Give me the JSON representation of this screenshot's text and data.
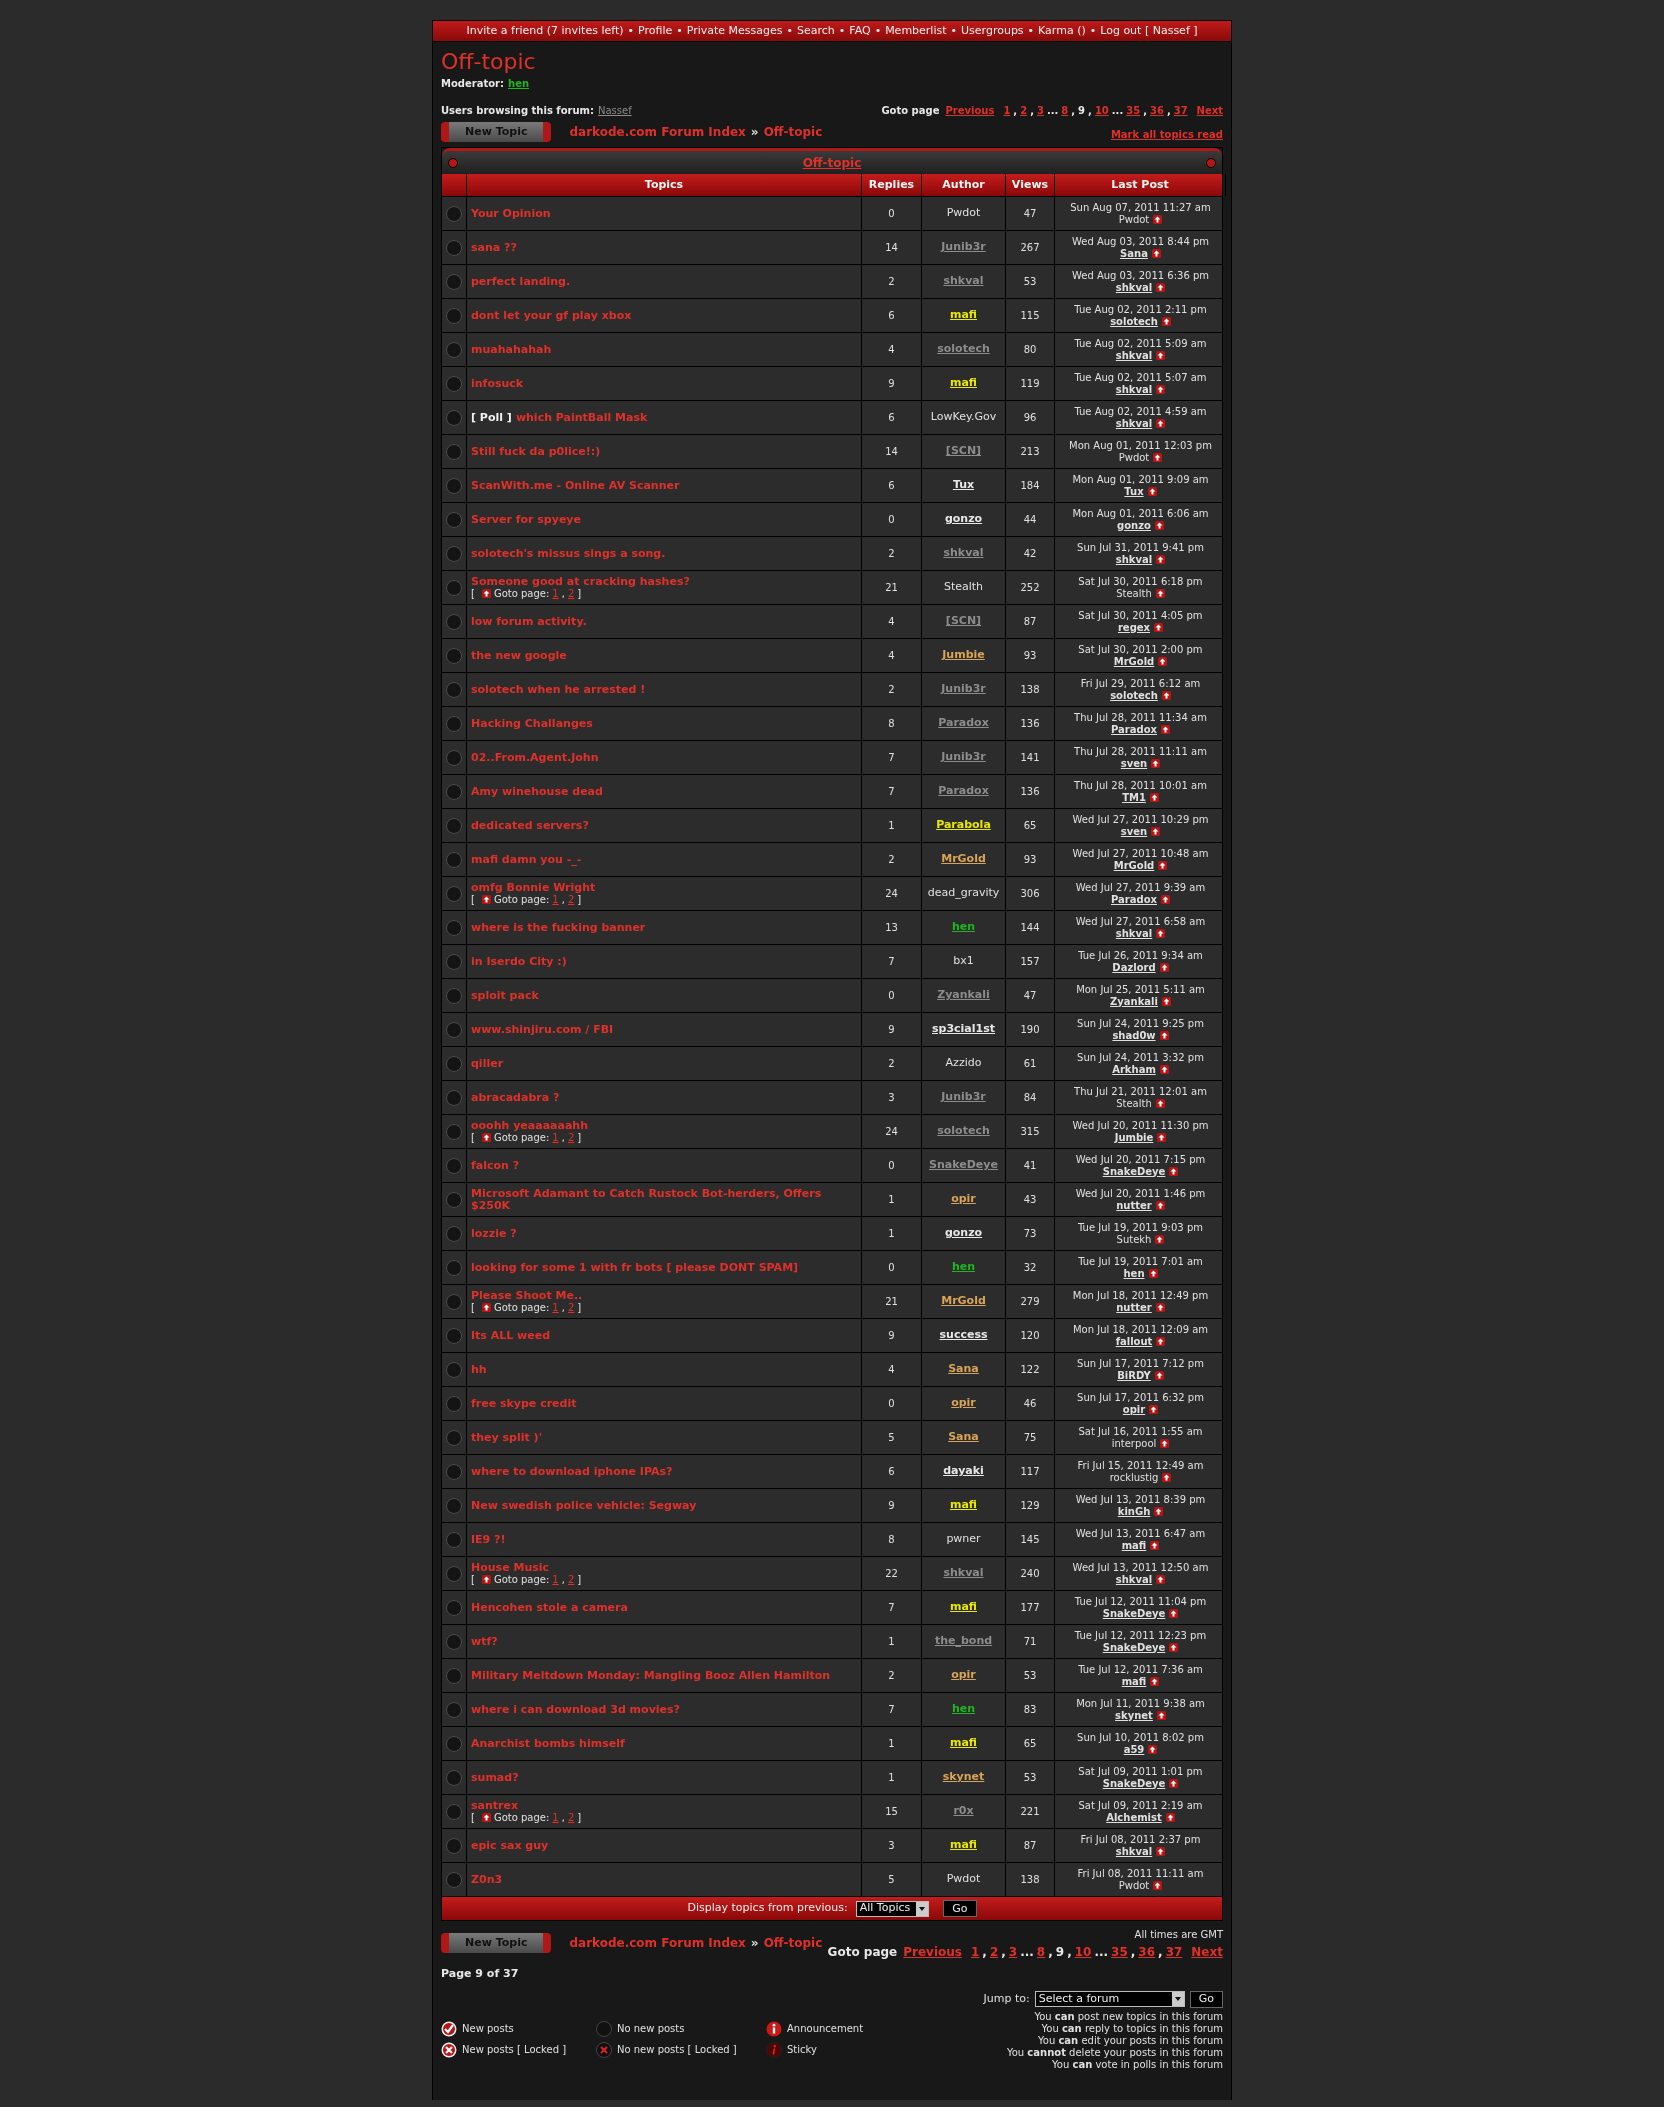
{
  "nav": {
    "separator": "•",
    "items": [
      "Invite a friend (7 invites left)",
      "Profile",
      "Private Messages",
      "Search",
      "FAQ",
      "Memberlist",
      "Usergroups",
      "Karma ()",
      "Log out [ Nassef ]"
    ]
  },
  "forum_title": "Off-topic",
  "moderator": {
    "label": "Moderator:",
    "name": "hen",
    "color": "#21b521"
  },
  "browsing": {
    "label": "Users browsing this forum:",
    "name": "Nassef",
    "color": "#8c8c8c"
  },
  "top_bar": {
    "goto_label": "Goto page",
    "pagination": [
      {
        "text": "Previous",
        "link": true
      },
      {
        "text": "1",
        "link": true
      },
      {
        "text": ",",
        "link": false
      },
      {
        "text": "2",
        "link": true
      },
      {
        "text": ",",
        "link": false
      },
      {
        "text": "3",
        "link": true
      },
      {
        "text": "...",
        "link": false
      },
      {
        "text": "8",
        "link": true
      },
      {
        "text": ",",
        "link": false
      },
      {
        "text": "9",
        "link": false
      },
      {
        "text": ",",
        "link": false
      },
      {
        "text": "10",
        "link": true
      },
      {
        "text": "...",
        "link": false
      },
      {
        "text": "35",
        "link": true
      },
      {
        "text": ",",
        "link": false
      },
      {
        "text": "36",
        "link": true
      },
      {
        "text": ",",
        "link": false
      },
      {
        "text": "37",
        "link": true
      },
      {
        "text": "Next",
        "link": true
      }
    ],
    "new_topic": "New Topic",
    "breadcrumb": {
      "index": "darkode.com Forum Index",
      "separator": "»",
      "forum": "Off-topic"
    },
    "mark_read": "Mark all topics read"
  },
  "table": {
    "caption": "Off-topic",
    "columns": [
      "Topics",
      "Replies",
      "Author",
      "Views",
      "Last Post"
    ]
  },
  "topics": [
    {
      "title": "Your Opinion",
      "replies": "0",
      "author": {
        "name": "Pwdot",
        "color": "#e0e0e0",
        "link": false
      },
      "views": "47",
      "last_date": "Sun Aug 07, 2011 11:27 am",
      "last_user": {
        "name": "Pwdot",
        "link": false
      }
    },
    {
      "title": "sana ??",
      "replies": "14",
      "author": {
        "name": "Junib3r",
        "color": "#8c8c8c",
        "link": true
      },
      "views": "267",
      "last_date": "Wed Aug 03, 2011 8:44 pm",
      "last_user": {
        "name": "Sana",
        "link": true
      }
    },
    {
      "title": "perfect landing.",
      "replies": "2",
      "author": {
        "name": "shkval",
        "color": "#8c8c8c",
        "link": true
      },
      "views": "53",
      "last_date": "Wed Aug 03, 2011 6:36 pm",
      "last_user": {
        "name": "shkval",
        "link": true
      }
    },
    {
      "title": "dont let your gf play xbox",
      "replies": "6",
      "author": {
        "name": "mafi",
        "color": "#e8e800",
        "link": true
      },
      "views": "115",
      "last_date": "Tue Aug 02, 2011 2:11 pm",
      "last_user": {
        "name": "solotech",
        "link": true
      }
    },
    {
      "title": "muahahahah",
      "replies": "4",
      "author": {
        "name": "solotech",
        "color": "#8c8c8c",
        "link": true
      },
      "views": "80",
      "last_date": "Tue Aug 02, 2011 5:09 am",
      "last_user": {
        "name": "shkval",
        "link": true
      }
    },
    {
      "title": "infosuck",
      "replies": "9",
      "author": {
        "name": "mafi",
        "color": "#e8e800",
        "link": true
      },
      "views": "119",
      "last_date": "Tue Aug 02, 2011 5:07 am",
      "last_user": {
        "name": "shkval",
        "link": true
      }
    },
    {
      "prefix": "[ Poll ]",
      "title": "which PaintBall Mask",
      "replies": "6",
      "author": {
        "name": "LowKey.Gov",
        "color": "#e0e0e0",
        "link": false
      },
      "views": "96",
      "last_date": "Tue Aug 02, 2011 4:59 am",
      "last_user": {
        "name": "shkval",
        "link": true
      }
    },
    {
      "title": "Still fuck da p0lice!:)",
      "replies": "14",
      "author": {
        "name": "[SCN]",
        "color": "#8c8c8c",
        "link": true
      },
      "views": "213",
      "last_date": "Mon Aug 01, 2011 12:03 pm",
      "last_user": {
        "name": "Pwdot",
        "link": false
      }
    },
    {
      "title": "ScanWith.me - Online AV Scanner",
      "replies": "6",
      "author": {
        "name": "Tux",
        "color": "#e8e8e8",
        "link": true
      },
      "views": "184",
      "last_date": "Mon Aug 01, 2011 9:09 am",
      "last_user": {
        "name": "Tux",
        "link": true
      }
    },
    {
      "title": "Server for spyeye",
      "replies": "0",
      "author": {
        "name": "gonzo",
        "color": "#e8e8e8",
        "link": true
      },
      "views": "44",
      "last_date": "Mon Aug 01, 2011 6:06 am",
      "last_user": {
        "name": "gonzo",
        "link": true
      }
    },
    {
      "title": "solotech's missus sings a song.",
      "replies": "2",
      "author": {
        "name": "shkval",
        "color": "#8c8c8c",
        "link": true
      },
      "views": "42",
      "last_date": "Sun Jul 31, 2011 9:41 pm",
      "last_user": {
        "name": "shkval",
        "link": true
      }
    },
    {
      "title": "Someone good at cracking hashes?",
      "goto": {
        "open": "[",
        "label": "Goto page:",
        "pages": [
          "1",
          "2"
        ],
        "separator": ",",
        "close": "]"
      },
      "replies": "21",
      "author": {
        "name": "Stealth",
        "color": "#e0e0e0",
        "link": false
      },
      "views": "252",
      "last_date": "Sat Jul 30, 2011 6:18 pm",
      "last_user": {
        "name": "Stealth",
        "link": false
      }
    },
    {
      "title": "low forum activity.",
      "replies": "4",
      "author": {
        "name": "[SCN]",
        "color": "#8c8c8c",
        "link": true
      },
      "views": "87",
      "last_date": "Sat Jul 30, 2011 4:05 pm",
      "last_user": {
        "name": "regex",
        "link": true
      }
    },
    {
      "title": "the new google",
      "replies": "4",
      "author": {
        "name": "Jumbie",
        "color": "#d8a45a",
        "link": true
      },
      "views": "93",
      "last_date": "Sat Jul 30, 2011 2:00 pm",
      "last_user": {
        "name": "MrGold",
        "link": true
      }
    },
    {
      "title": "solotech when he arrested !",
      "replies": "2",
      "author": {
        "name": "Junib3r",
        "color": "#8c8c8c",
        "link": true
      },
      "views": "138",
      "last_date": "Fri Jul 29, 2011 6:12 am",
      "last_user": {
        "name": "solotech",
        "link": true
      }
    },
    {
      "title": "Hacking Challanges",
      "replies": "8",
      "author": {
        "name": "Paradox",
        "color": "#8c8c8c",
        "link": true
      },
      "views": "136",
      "last_date": "Thu Jul 28, 2011 11:34 am",
      "last_user": {
        "name": "Paradox",
        "link": true
      }
    },
    {
      "title": "02..From.Agent.John",
      "replies": "7",
      "author": {
        "name": "Junib3r",
        "color": "#8c8c8c",
        "link": true
      },
      "views": "141",
      "last_date": "Thu Jul 28, 2011 11:11 am",
      "last_user": {
        "name": "sven",
        "link": true
      }
    },
    {
      "title": "Amy winehouse dead",
      "replies": "7",
      "author": {
        "name": "Paradox",
        "color": "#8c8c8c",
        "link": true
      },
      "views": "136",
      "last_date": "Thu Jul 28, 2011 10:01 am",
      "last_user": {
        "name": "TM1",
        "link": true
      }
    },
    {
      "title": "dedicated servers?",
      "replies": "1",
      "author": {
        "name": "Parabola",
        "color": "#e8e800",
        "link": true
      },
      "views": "65",
      "last_date": "Wed Jul 27, 2011 10:29 pm",
      "last_user": {
        "name": "sven",
        "link": true
      }
    },
    {
      "title": "mafi damn you -_-",
      "replies": "2",
      "author": {
        "name": "MrGold",
        "color": "#d8a45a",
        "link": true
      },
      "views": "93",
      "last_date": "Wed Jul 27, 2011 10:48 am",
      "last_user": {
        "name": "MrGold",
        "link": true
      }
    },
    {
      "title": "omfg Bonnie Wright",
      "goto": {
        "open": "[",
        "label": "Goto page:",
        "pages": [
          "1",
          "2"
        ],
        "separator": ",",
        "close": "]"
      },
      "replies": "24",
      "author": {
        "name": "dead_gravity",
        "color": "#e0e0e0",
        "link": false
      },
      "views": "306",
      "last_date": "Wed Jul 27, 2011 9:39 am",
      "last_user": {
        "name": "Paradox",
        "link": true
      }
    },
    {
      "title": "where is the fucking banner",
      "replies": "13",
      "author": {
        "name": "hen",
        "color": "#21b521",
        "link": true
      },
      "views": "144",
      "last_date": "Wed Jul 27, 2011 6:58 am",
      "last_user": {
        "name": "shkval",
        "link": true
      }
    },
    {
      "title": "in Iserdo City :)",
      "replies": "7",
      "author": {
        "name": "bx1",
        "color": "#e0e0e0",
        "link": false
      },
      "views": "157",
      "last_date": "Tue Jul 26, 2011 9:34 am",
      "last_user": {
        "name": "Dazlord",
        "link": true
      }
    },
    {
      "title": "sploit pack",
      "replies": "0",
      "author": {
        "name": "Zyankali",
        "color": "#8c8c8c",
        "link": true
      },
      "views": "47",
      "last_date": "Mon Jul 25, 2011 5:11 am",
      "last_user": {
        "name": "Zyankali",
        "link": true
      }
    },
    {
      "title": "www.shinjiru.com / FBI",
      "replies": "9",
      "author": {
        "name": "sp3cial1st",
        "color": "#e8e8e8",
        "link": true
      },
      "views": "190",
      "last_date": "Sun Jul 24, 2011 9:25 pm",
      "last_user": {
        "name": "shad0w",
        "link": true
      }
    },
    {
      "title": "qiller",
      "replies": "2",
      "author": {
        "name": "Azzido",
        "color": "#e0e0e0",
        "link": false
      },
      "views": "61",
      "last_date": "Sun Jul 24, 2011 3:32 pm",
      "last_user": {
        "name": "Arkham",
        "link": true
      }
    },
    {
      "title": "abracadabra ?",
      "replies": "3",
      "author": {
        "name": "Junib3r",
        "color": "#8c8c8c",
        "link": true
      },
      "views": "84",
      "last_date": "Thu Jul 21, 2011 12:01 am",
      "last_user": {
        "name": "Stealth",
        "link": false
      }
    },
    {
      "title": "ooohh yeaaaaaahh",
      "goto": {
        "open": "[",
        "label": "Goto page:",
        "pages": [
          "1",
          "2"
        ],
        "separator": ",",
        "close": "]"
      },
      "replies": "24",
      "author": {
        "name": "solotech",
        "color": "#8c8c8c",
        "link": true
      },
      "views": "315",
      "last_date": "Wed Jul 20, 2011 11:30 pm",
      "last_user": {
        "name": "Jumbie",
        "link": true
      }
    },
    {
      "title": "falcon ?",
      "replies": "0",
      "author": {
        "name": "SnakeDeye",
        "color": "#8c8c8c",
        "link": true
      },
      "views": "41",
      "last_date": "Wed Jul 20, 2011 7:15 pm",
      "last_user": {
        "name": "SnakeDeye",
        "link": true
      }
    },
    {
      "title": "Microsoft Adamant to Catch Rustock Bot-herders, Offers $250K",
      "replies": "1",
      "author": {
        "name": "opir",
        "color": "#d8a45a",
        "link": true
      },
      "views": "43",
      "last_date": "Wed Jul 20, 2011 1:46 pm",
      "last_user": {
        "name": "nutter",
        "link": true
      }
    },
    {
      "title": "lozzie ?",
      "replies": "1",
      "author": {
        "name": "gonzo",
        "color": "#e8e8e8",
        "link": true
      },
      "views": "73",
      "last_date": "Tue Jul 19, 2011 9:03 pm",
      "last_user": {
        "name": "Sutekh",
        "link": false
      }
    },
    {
      "title": "looking for some 1 with fr bots [ please DONT SPAM]",
      "replies": "0",
      "author": {
        "name": "hen",
        "color": "#21b521",
        "link": true
      },
      "views": "32",
      "last_date": "Tue Jul 19, 2011 7:01 am",
      "last_user": {
        "name": "hen",
        "link": true
      }
    },
    {
      "title": "Please Shoot Me..",
      "goto": {
        "open": "[",
        "label": "Goto page:",
        "pages": [
          "1",
          "2"
        ],
        "separator": ",",
        "close": "]"
      },
      "replies": "21",
      "author": {
        "name": "MrGold",
        "color": "#d8a45a",
        "link": true
      },
      "views": "279",
      "last_date": "Mon Jul 18, 2011 12:49 pm",
      "last_user": {
        "name": "nutter",
        "link": true
      }
    },
    {
      "title": "Its ALL weed",
      "replies": "9",
      "author": {
        "name": "success",
        "color": "#e8e8e8",
        "link": true
      },
      "views": "120",
      "last_date": "Mon Jul 18, 2011 12:09 am",
      "last_user": {
        "name": "fallout",
        "link": true
      }
    },
    {
      "title": "hh",
      "replies": "4",
      "author": {
        "name": "Sana",
        "color": "#d8a45a",
        "link": true
      },
      "views": "122",
      "last_date": "Sun Jul 17, 2011 7:12 pm",
      "last_user": {
        "name": "BiRDY",
        "link": true
      }
    },
    {
      "title": "free skype credit",
      "replies": "0",
      "author": {
        "name": "opir",
        "color": "#d8a45a",
        "link": true
      },
      "views": "46",
      "last_date": "Sun Jul 17, 2011 6:32 pm",
      "last_user": {
        "name": "opir",
        "link": true
      }
    },
    {
      "title": "they split )'",
      "replies": "5",
      "author": {
        "name": "Sana",
        "color": "#d8a45a",
        "link": true
      },
      "views": "75",
      "last_date": "Sat Jul 16, 2011 1:55 am",
      "last_user": {
        "name": "interpool",
        "link": false
      }
    },
    {
      "title": "where to download iphone IPAs?",
      "replies": "6",
      "author": {
        "name": "dayaki",
        "color": "#e8e8e8",
        "link": true
      },
      "views": "117",
      "last_date": "Fri Jul 15, 2011 12:49 am",
      "last_user": {
        "name": "rocklustig",
        "link": false
      }
    },
    {
      "title": "New swedish police vehicle: Segway",
      "replies": "9",
      "author": {
        "name": "mafi",
        "color": "#e8e800",
        "link": true
      },
      "views": "129",
      "last_date": "Wed Jul 13, 2011 8:39 pm",
      "last_user": {
        "name": "kinGh",
        "link": true
      }
    },
    {
      "title": "IE9 ?!",
      "replies": "8",
      "author": {
        "name": "pwner",
        "color": "#e0e0e0",
        "link": false
      },
      "views": "145",
      "last_date": "Wed Jul 13, 2011 6:47 am",
      "last_user": {
        "name": "mafi",
        "link": true
      }
    },
    {
      "title": "House Music",
      "goto": {
        "open": "[",
        "label": "Goto page:",
        "pages": [
          "1",
          "2"
        ],
        "separator": ",",
        "close": "]"
      },
      "replies": "22",
      "author": {
        "name": "shkval",
        "color": "#8c8c8c",
        "link": true
      },
      "views": "240",
      "last_date": "Wed Jul 13, 2011 12:50 am",
      "last_user": {
        "name": "shkval",
        "link": true
      }
    },
    {
      "title": "Hencohen stole a camera",
      "replies": "7",
      "author": {
        "name": "mafi",
        "color": "#e8e800",
        "link": true
      },
      "views": "177",
      "last_date": "Tue Jul 12, 2011 11:04 pm",
      "last_user": {
        "name": "SnakeDeye",
        "link": true
      }
    },
    {
      "title": "wtf?",
      "replies": "1",
      "author": {
        "name": "the_bond",
        "color": "#8c8c8c",
        "link": true
      },
      "views": "71",
      "last_date": "Tue Jul 12, 2011 12:23 pm",
      "last_user": {
        "name": "SnakeDeye",
        "link": true
      }
    },
    {
      "title": "Military Meltdown Monday: Mangling Booz Allen Hamilton",
      "replies": "2",
      "author": {
        "name": "opir",
        "color": "#d8a45a",
        "link": true
      },
      "views": "53",
      "last_date": "Tue Jul 12, 2011 7:36 am",
      "last_user": {
        "name": "mafi",
        "link": true
      }
    },
    {
      "title": "where i can download 3d movies?",
      "replies": "7",
      "author": {
        "name": "hen",
        "color": "#21b521",
        "link": true
      },
      "views": "83",
      "last_date": "Mon Jul 11, 2011 9:38 am",
      "last_user": {
        "name": "skynet",
        "link": true
      }
    },
    {
      "title": "Anarchist bombs himself",
      "replies": "1",
      "author": {
        "name": "mafi",
        "color": "#e8e800",
        "link": true
      },
      "views": "65",
      "last_date": "Sun Jul 10, 2011 8:02 pm",
      "last_user": {
        "name": "a59",
        "link": true
      }
    },
    {
      "title": "sumad?",
      "replies": "1",
      "author": {
        "name": "skynet",
        "color": "#d8a45a",
        "link": true
      },
      "views": "53",
      "last_date": "Sat Jul 09, 2011 1:01 pm",
      "last_user": {
        "name": "SnakeDeye",
        "link": true
      }
    },
    {
      "title": "santrex",
      "goto": {
        "open": "[",
        "label": "Goto page:",
        "pages": [
          "1",
          "2"
        ],
        "separator": ",",
        "close": "]"
      },
      "replies": "15",
      "author": {
        "name": "r0x",
        "color": "#8c8c8c",
        "link": true
      },
      "views": "221",
      "last_date": "Sat Jul 09, 2011 2:19 am",
      "last_user": {
        "name": "Alchemist",
        "link": true
      }
    },
    {
      "title": "epic sax guy",
      "replies": "3",
      "author": {
        "name": "mafi",
        "color": "#e8e800",
        "link": true
      },
      "views": "87",
      "last_date": "Fri Jul 08, 2011 2:37 pm",
      "last_user": {
        "name": "shkval",
        "link": true
      }
    },
    {
      "title": "Z0n3",
      "replies": "5",
      "author": {
        "name": "Pwdot",
        "color": "#e0e0e0",
        "link": false
      },
      "views": "138",
      "last_date": "Fri Jul 08, 2011 11:11 am",
      "last_user": {
        "name": "Pwdot",
        "link": false
      }
    }
  ],
  "display_filter": {
    "label": "Display topics from previous:",
    "value": "All Topics",
    "button": "Go"
  },
  "bottom_bar": {
    "new_topic": "New Topic",
    "breadcrumb": {
      "index": "darkode.com Forum Index",
      "separator": "»",
      "forum": "Off-topic"
    },
    "timezone": "All times are GMT",
    "goto_label": "Goto page",
    "pagination": [
      {
        "text": "Previous",
        "link": true
      },
      {
        "text": "1",
        "link": true
      },
      {
        "text": ",",
        "link": false
      },
      {
        "text": "2",
        "link": true
      },
      {
        "text": ",",
        "link": false
      },
      {
        "text": "3",
        "link": true
      },
      {
        "text": "...",
        "link": false
      },
      {
        "text": "8",
        "link": true
      },
      {
        "text": ",",
        "link": false
      },
      {
        "text": "9",
        "link": false
      },
      {
        "text": ",",
        "link": false
      },
      {
        "text": "10",
        "link": true
      },
      {
        "text": "...",
        "link": false
      },
      {
        "text": "35",
        "link": true
      },
      {
        "text": ",",
        "link": false
      },
      {
        "text": "36",
        "link": true
      },
      {
        "text": ",",
        "link": false
      },
      {
        "text": "37",
        "link": true
      },
      {
        "text": "Next",
        "link": true
      }
    ],
    "page_info": "Page 9 of 37"
  },
  "jump": {
    "label": "Jump to:",
    "value": "Select a forum",
    "button": "Go"
  },
  "legend": [
    {
      "kind": "new",
      "label": "New posts"
    },
    {
      "kind": "no_new",
      "label": "No new posts"
    },
    {
      "kind": "announcement",
      "label": "Announcement"
    },
    {
      "kind": "new_locked",
      "label": "New posts [ Locked ]"
    },
    {
      "kind": "no_new_locked",
      "label": "No new posts [ Locked ]"
    },
    {
      "kind": "sticky",
      "label": "Sticky"
    }
  ],
  "permissions": [
    "You **can** post new topics in this forum",
    "You **can** reply to topics in this forum",
    "You **can** edit your posts in this forum",
    "You **cannot** delete your posts in this forum",
    "You **can** vote in polls in this forum"
  ]
}
